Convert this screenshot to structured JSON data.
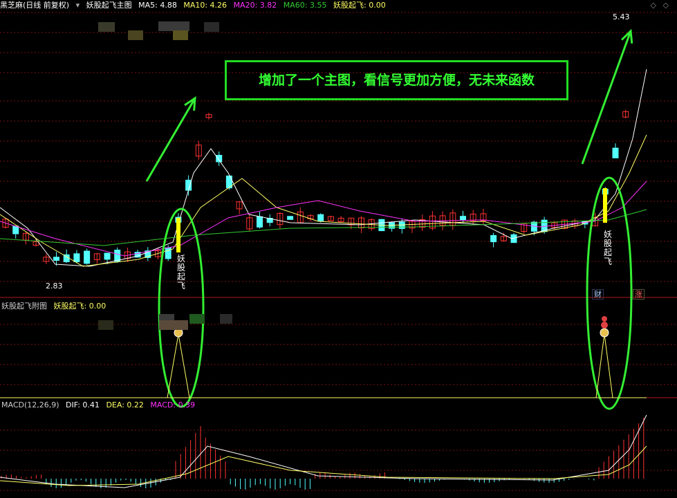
{
  "main_header": {
    "stock_name": "黑芝麻(日线 前复权)",
    "indicator_name": "妖股起飞主图",
    "ma5": "MA5: 4.88",
    "ma10": "MA10: 4.26",
    "ma20": "MA20: 3.82",
    "ma60": "MA60: 3.55",
    "signal": "妖股起飞: 0.00"
  },
  "price_labels": {
    "high": "5.43",
    "low": "2.83"
  },
  "callout_text": "增加了一个主图，看信号更加方便，无未来函数",
  "signal_label_left": "妖股起飞",
  "signal_label_right": "妖股起飞",
  "event_tags": {
    "finance": "财",
    "limit_up": "涨"
  },
  "sub_header": {
    "title": "妖股起飞附图",
    "signal": "妖股起飞: 0.00"
  },
  "macd_header": {
    "title": "MACD(12,26,9)",
    "dif": "DIF: 0.41",
    "dea": "DEA: 0.22",
    "macd": "MACD: 0.39"
  },
  "colors": {
    "up": "#ff3232",
    "down": "#54ffff",
    "ma5": "#ffffff",
    "ma10": "#ffff66",
    "ma20": "#ff33ff",
    "ma60": "#33cc33",
    "highlight": "#33ff33",
    "grid": "#7a1010"
  }
}
